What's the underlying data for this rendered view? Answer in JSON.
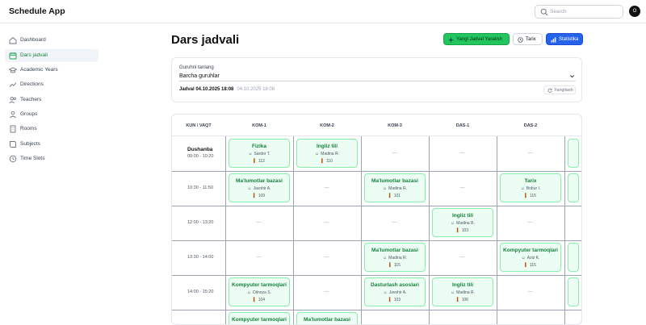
{
  "app": {
    "title": "Schedule App"
  },
  "search": {
    "placeholder": "Search"
  },
  "user": {
    "initial": "O"
  },
  "sidebar": {
    "items": [
      {
        "label": "Dashboard",
        "icon": "dashboard-icon"
      },
      {
        "label": "Dars jadvali",
        "icon": "calendar-icon",
        "active": true
      },
      {
        "label": "Academic Years",
        "icon": "graduation-cap-icon"
      },
      {
        "label": "Directions",
        "icon": "trend-icon"
      },
      {
        "label": "Teachers",
        "icon": "users-icon"
      },
      {
        "label": "Groups",
        "icon": "group-icon"
      },
      {
        "label": "Rooms",
        "icon": "building-icon"
      },
      {
        "label": "Subjects",
        "icon": "book-icon"
      },
      {
        "label": "Time Slots",
        "icon": "clock-icon"
      }
    ]
  },
  "page": {
    "title": "Dars jadvali",
    "buttons": {
      "new_schedule": "Yangi Jadval Yaratish",
      "history": "Tarix",
      "stats": "Statistika"
    }
  },
  "filter": {
    "label": "Guruhni tanlang",
    "selected": "Barcha guruhlar",
    "schedule_label": "Jadval 04.10.2025 18:08",
    "schedule_sub": "04.10.2025 18:08",
    "refresh": "Yangilash"
  },
  "table": {
    "headers": [
      "KUN / VAQT",
      "KOM-1",
      "KOM-2",
      "KOM-3",
      "DAS-1",
      "DAS-2"
    ],
    "empty": "—",
    "rows": [
      {
        "day": "Dushanba",
        "time": "09:00 - 10:20",
        "cells": [
          {
            "subject": "Fizika",
            "teacher": "Sardor T.",
            "room": "112"
          },
          {
            "subject": "Ingliz tili",
            "teacher": "Madina R.",
            "room": "110"
          },
          null,
          null,
          null
        ]
      },
      {
        "day": "",
        "time": "10:30 - 11:50",
        "cells": [
          {
            "subject": "Ma'lumotlar bazasi",
            "teacher": "Javohir A.",
            "room": "109"
          },
          null,
          {
            "subject": "Ma'lumotlar bazasi",
            "teacher": "Madina R.",
            "room": "101"
          },
          null,
          {
            "subject": "Tarix",
            "teacher": "Bobur I.",
            "room": "115"
          }
        ]
      },
      {
        "day": "",
        "time": "12:00 - 13:20",
        "cells": [
          null,
          null,
          null,
          {
            "subject": "Ingliz tili",
            "teacher": "Madina R.",
            "room": "103"
          },
          null
        ]
      },
      {
        "day": "",
        "time": "13:30 - 14:00",
        "cells": [
          null,
          null,
          {
            "subject": "Ma'lumotlar bazasi",
            "teacher": "Madina R.",
            "room": "115"
          },
          null,
          {
            "subject": "Kompyuter tarmoqlari",
            "teacher": "Aziz K.",
            "room": "115"
          }
        ]
      },
      {
        "day": "",
        "time": "14:00 - 15:20",
        "cells": [
          {
            "subject": "Kompyuter tarmoqlari",
            "teacher": "Dilnoza S.",
            "room": "104"
          },
          null,
          {
            "subject": "Dasturlash asoslari",
            "teacher": "Javohir A.",
            "room": "103"
          },
          {
            "subject": "Ingliz tili",
            "teacher": "Madina R.",
            "room": "106"
          },
          null
        ]
      },
      {
        "day": "",
        "time": "",
        "cells": [
          {
            "subject": "Kompyuter tarmoqlari",
            "teacher": "",
            "room": ""
          },
          {
            "subject": "Ma'lumotlar bazasi",
            "teacher": "",
            "room": ""
          },
          null,
          null,
          null
        ]
      }
    ]
  }
}
